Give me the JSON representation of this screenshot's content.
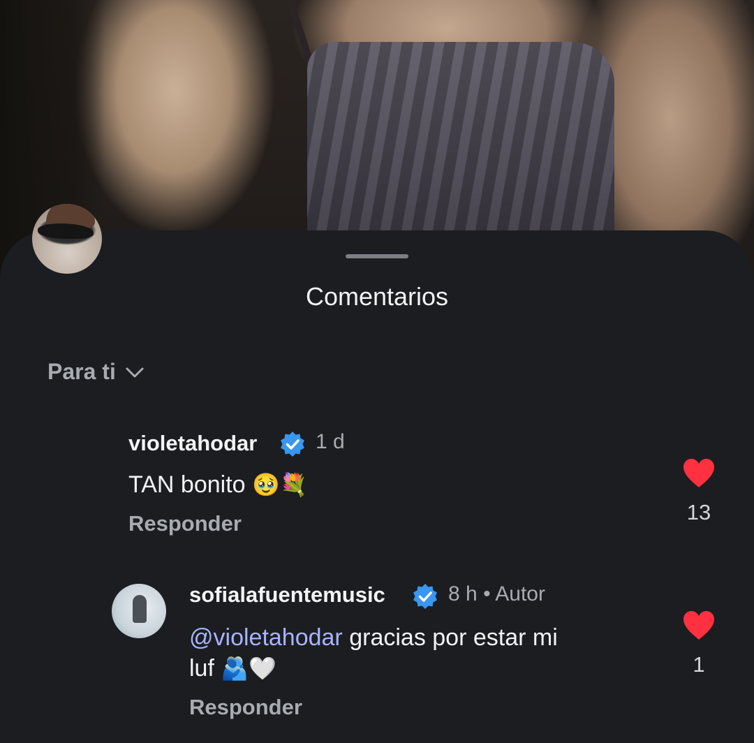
{
  "sheet": {
    "title": "Comentarios",
    "sort_label": "Para ti"
  },
  "comments": [
    {
      "username": "violetahodar",
      "verified": true,
      "time": "1 d",
      "text": "TAN bonito",
      "emojis": "🥹💐",
      "reply_label": "Responder",
      "likes": "13"
    },
    {
      "username": "sofialafuentemusic",
      "verified": true,
      "time": "8 h",
      "separator": "•",
      "author_badge": "Autor",
      "mention": "@violetahodar",
      "text_line1": " gracias por estar mi",
      "text_line2": "luf",
      "emojis": "🫂🤍",
      "reply_label": "Responder",
      "likes": "1"
    }
  ],
  "colors": {
    "sheet_bg": "#1b1d20",
    "heart": "#ff3040",
    "verified": "#3897f0",
    "mention": "#a9b3ff"
  },
  "icons": [
    "chevron-down-icon",
    "verified-badge-icon",
    "heart-filled-icon"
  ]
}
